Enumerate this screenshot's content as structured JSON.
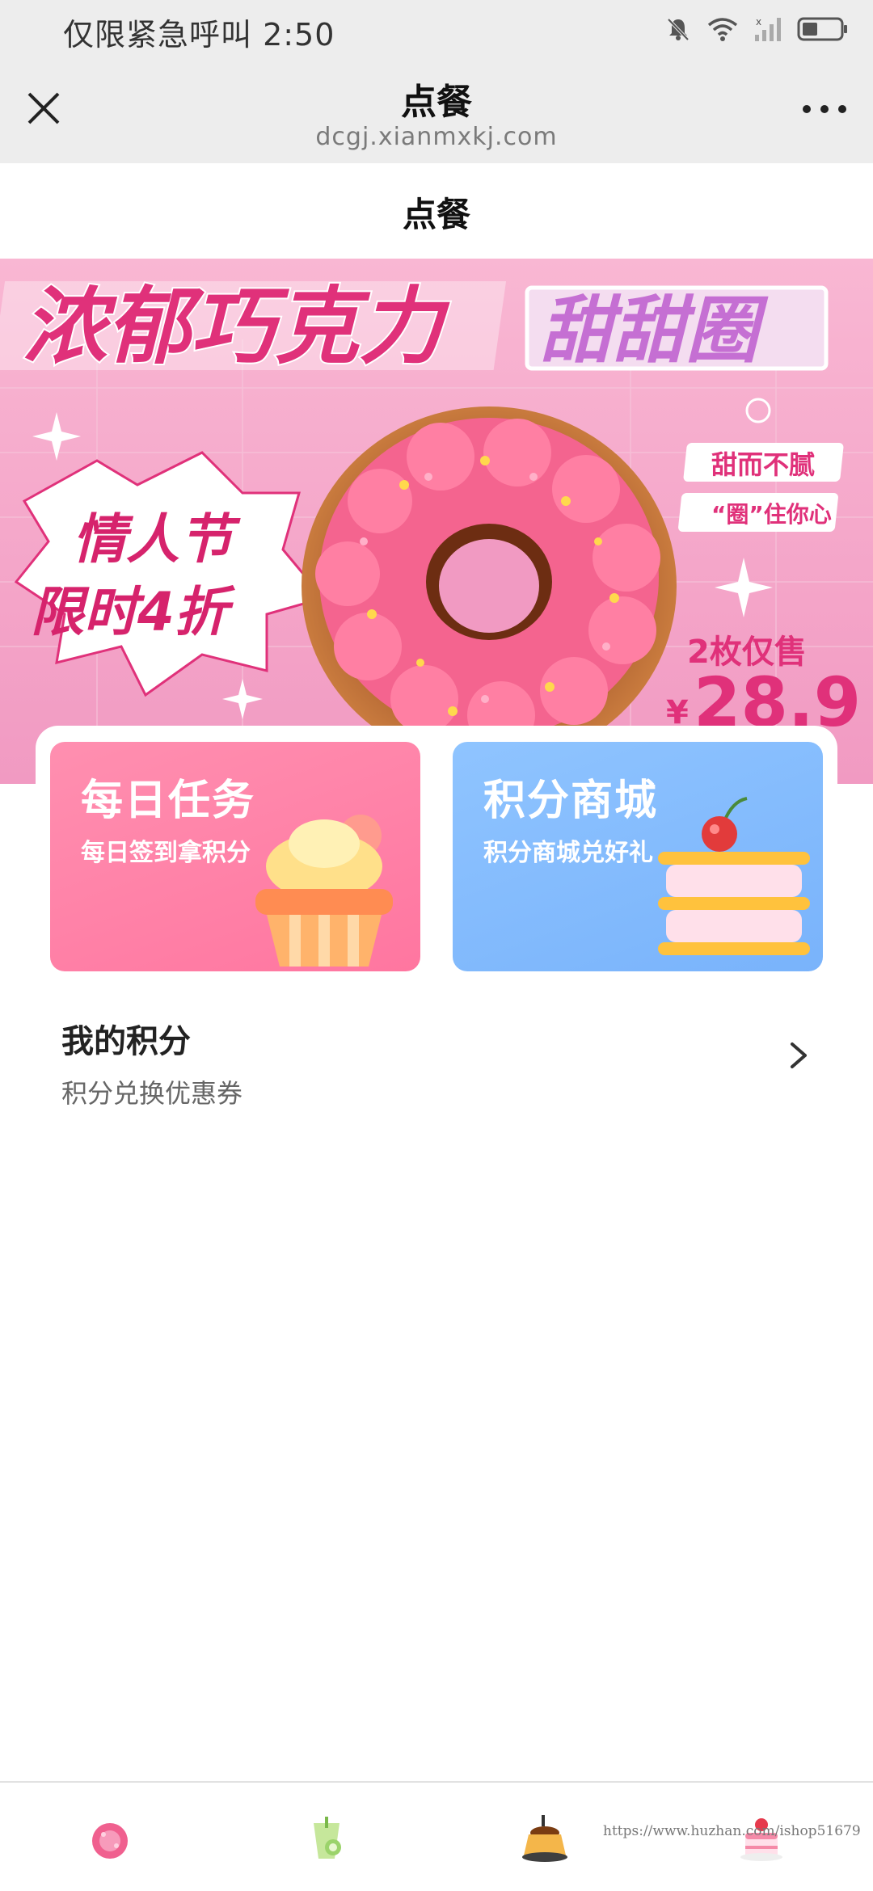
{
  "status_bar": {
    "text": "仅限紧急呼叫 2:50",
    "icons": [
      "bell-muted-icon",
      "wifi-icon",
      "signal-icon",
      "battery-icon"
    ]
  },
  "browser": {
    "title": "点餐",
    "url": "dcgj.xianmxkj.com",
    "close_icon": "close-icon",
    "more_icon": "more-icon"
  },
  "page": {
    "title": "点餐"
  },
  "banner": {
    "headline_main": "浓郁巧克力",
    "headline_tag": "甜甜圈",
    "promo_line1": "情人节",
    "promo_line2": "限时4折",
    "side_tag1": "甜而不腻",
    "side_tag2": "“圈”住你心",
    "price_label": "2枚仅售",
    "price_currency": "¥",
    "price_value": "28.9"
  },
  "cards": [
    {
      "title": "每日任务",
      "subtitle": "每日签到拿积分",
      "icon": "cupcake-icon",
      "color": "#ff7fa6"
    },
    {
      "title": "积分商城",
      "subtitle": "积分商城兑好礼",
      "icon": "cake-icon",
      "color": "#84bcfd"
    }
  ],
  "points": {
    "title": "我的积分",
    "subtitle": "积分兑换优惠券",
    "icon": "chevron-right-icon"
  },
  "tabbar": {
    "items": [
      {
        "icon": "pink-dessert-icon"
      },
      {
        "icon": "green-drink-icon"
      },
      {
        "icon": "pudding-icon"
      },
      {
        "icon": "strawberry-cake-icon"
      }
    ],
    "watermark": "https://www.huzhan.com/ishop51679"
  },
  "colors": {
    "accent_pink": "#ff4f8b",
    "banner_bg": "#f7a6c9",
    "header_bg": "#ededed"
  }
}
